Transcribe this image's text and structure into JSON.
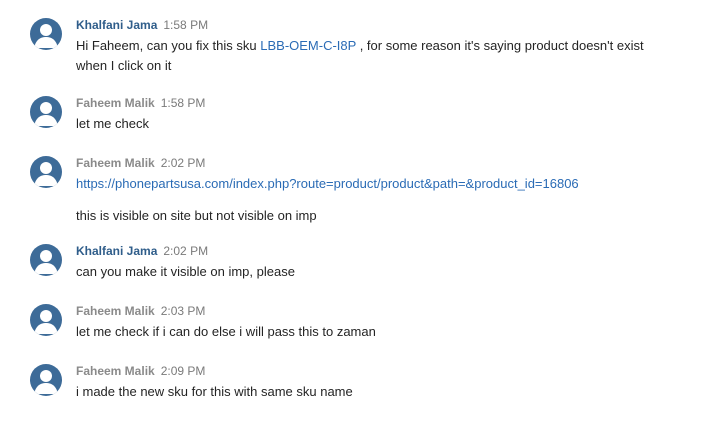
{
  "messages": [
    {
      "author": "Khalfani Jama",
      "time": "1:58 PM",
      "lines": [
        {
          "pre": "Hi Faheem, can you fix this sku ",
          "link": "LBB-OEM-C-I8P",
          "post": "  , for some reason it's saying product doesn't exist"
        },
        {
          "pre": "when I click on it",
          "link": "",
          "post": ""
        }
      ]
    },
    {
      "author": "Faheem Malik",
      "time": "1:58 PM",
      "lines": [
        {
          "pre": "let me check",
          "link": "",
          "post": ""
        }
      ]
    },
    {
      "author": "Faheem Malik",
      "time": "2:02 PM",
      "lines": [
        {
          "pre": "",
          "link": "https://phonepartsusa.com/index.php?route=product/product&path=&product_id=16806",
          "post": ""
        },
        {
          "pre": "this is visible on site but not visible on imp",
          "link": "",
          "post": ""
        }
      ]
    },
    {
      "author": "Khalfani Jama",
      "time": "2:02 PM",
      "lines": [
        {
          "pre": "can you make it visible on imp, please",
          "link": "",
          "post": ""
        }
      ]
    },
    {
      "author": "Faheem Malik",
      "time": "2:03 PM",
      "lines": [
        {
          "pre": "let me check if i can do else i will pass this to zaman",
          "link": "",
          "post": ""
        }
      ]
    },
    {
      "author": "Faheem Malik",
      "time": "2:09 PM",
      "lines": [
        {
          "pre": "i made the new sku for this with same sku name",
          "link": "",
          "post": ""
        }
      ]
    }
  ]
}
